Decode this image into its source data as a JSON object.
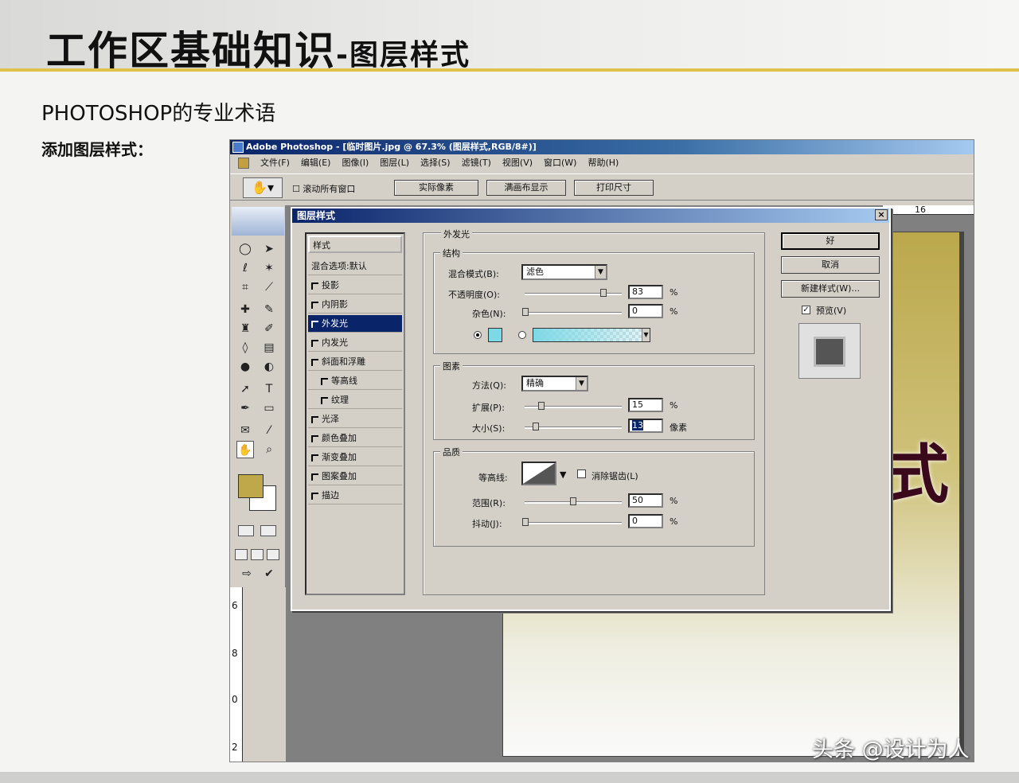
{
  "slide": {
    "title_main": "工作区基础知识",
    "title_sub": "-图层样式",
    "subheading": "PHOTOSHOP的专业术语",
    "add_label": "添加图层样式：",
    "watermark": "头条 @设计为人"
  },
  "photoshop": {
    "window_title": "Adobe Photoshop - [临时图片.jpg @ 67.3% (图层样式,RGB/8#)]",
    "menu": [
      "文件(F)",
      "编辑(E)",
      "图像(I)",
      "图层(L)",
      "选择(S)",
      "滤镜(T)",
      "视图(V)",
      "窗口(W)",
      "帮助(H)"
    ],
    "options_bar": {
      "scroll_all_windows": "滚动所有窗口",
      "actual_pixels": "实际像素",
      "fit_on_screen": "满画布显示",
      "print_size": "打印尺寸"
    },
    "ruler_top_value": "16",
    "ruler_left_values": [
      "6",
      "8",
      "0",
      "2"
    ],
    "document_char": "式",
    "colors": {
      "foreground": "#bfa84a",
      "background": "#ffffff",
      "glow": "#7dd9e6"
    }
  },
  "layer_style_dialog": {
    "title": "图层样式",
    "close": "×",
    "styles_header": "样式",
    "styles": [
      {
        "label": "混合选项:默认",
        "checkbox": false,
        "selected": false
      },
      {
        "label": "投影",
        "checkbox": true,
        "selected": false
      },
      {
        "label": "内阴影",
        "checkbox": true,
        "selected": false
      },
      {
        "label": "外发光",
        "checkbox": true,
        "selected": true
      },
      {
        "label": "内发光",
        "checkbox": true,
        "selected": false
      },
      {
        "label": "斜面和浮雕",
        "checkbox": true,
        "selected": false
      },
      {
        "label": "等高线",
        "checkbox": true,
        "selected": false
      },
      {
        "label": "纹理",
        "checkbox": true,
        "selected": false
      },
      {
        "label": "光泽",
        "checkbox": true,
        "selected": false
      },
      {
        "label": "颜色叠加",
        "checkbox": true,
        "selected": false
      },
      {
        "label": "渐变叠加",
        "checkbox": true,
        "selected": false
      },
      {
        "label": "图案叠加",
        "checkbox": true,
        "selected": false
      },
      {
        "label": "描边",
        "checkbox": true,
        "selected": false
      }
    ],
    "panel_title": "外发光",
    "structure": {
      "title": "结构",
      "blend_mode_label": "混合模式(B):",
      "blend_mode_value": "滤色",
      "opacity_label": "不透明度(O):",
      "opacity_value": "83",
      "opacity_level": 0.83,
      "noise_label": "杂色(N):",
      "noise_value": "0",
      "percent": "%"
    },
    "elements": {
      "title": "图素",
      "technique_label": "方法(Q):",
      "technique_value": "精确",
      "spread_label": "扩展(P):",
      "spread_value": "15",
      "spread_level": 0.15,
      "size_label": "大小(S):",
      "size_value": "13",
      "size_unit": "像素",
      "percent": "%"
    },
    "quality": {
      "title": "品质",
      "contour_label": "等高线:",
      "anti_aliased_label": "消除锯齿(L)",
      "range_label": "范围(R):",
      "range_value": "50",
      "range_level": 0.5,
      "jitter_label": "抖动(J):",
      "jitter_value": "0",
      "percent": "%"
    },
    "buttons": {
      "ok": "好",
      "cancel": "取消",
      "new_style": "新建样式(W)...",
      "preview": "预览(V)"
    }
  }
}
